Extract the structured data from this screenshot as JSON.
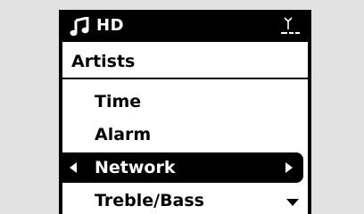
{
  "status_bar": {
    "source": "HD",
    "icons": [
      "music-note-icon",
      "antenna-signal-icon"
    ]
  },
  "header": {
    "title": "Artists"
  },
  "menu": {
    "items": [
      {
        "label": "Time"
      },
      {
        "label": "Alarm"
      },
      {
        "label": "Network",
        "selected": true
      },
      {
        "label": "Treble/Bass"
      }
    ],
    "icons": [
      "left-arrow-icon",
      "right-arrow-icon",
      "scroll-down-icon"
    ]
  },
  "colors": {
    "background": "#e2e2e2",
    "screen": "#ffffff",
    "foreground": "#000000",
    "highlight_text": "#ffffff"
  }
}
